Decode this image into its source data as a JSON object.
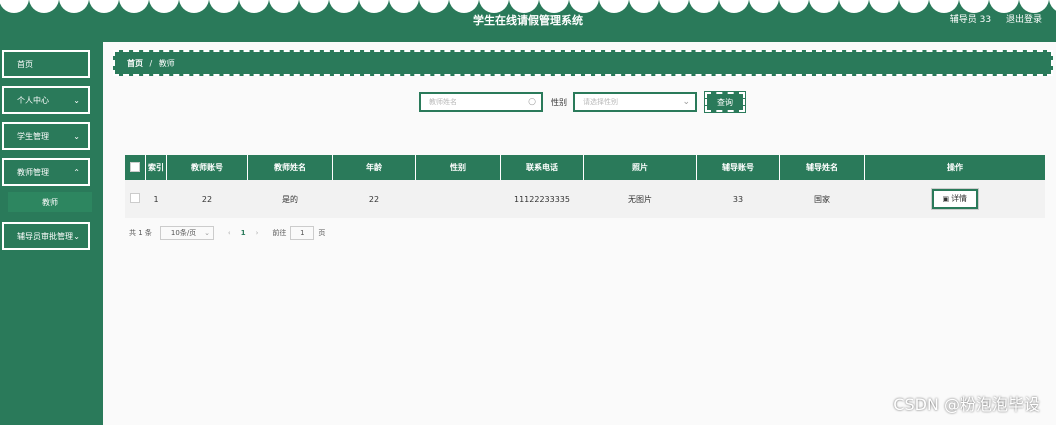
{
  "header": {
    "title": "学生在线请假管理系统",
    "user": "辅导员 33",
    "logout": "退出登录"
  },
  "sidebar": {
    "items": [
      {
        "label": "首页"
      },
      {
        "label": "个人中心"
      },
      {
        "label": "学生管理"
      },
      {
        "label": "教师管理"
      },
      {
        "label": "辅导员审批管理"
      }
    ],
    "submenu": "教师"
  },
  "breadcrumb": {
    "home": "首页",
    "sep": "/",
    "current": "教师"
  },
  "search": {
    "name_placeholder": "教师姓名",
    "gender_label": "性别",
    "gender_placeholder": "请选择性别",
    "query_label": "查询"
  },
  "table": {
    "headers": [
      "索引",
      "教师账号",
      "教师姓名",
      "年龄",
      "性别",
      "联系电话",
      "照片",
      "辅导账号",
      "辅导姓名",
      "操作"
    ],
    "rows": [
      {
        "index": "1",
        "account": "22",
        "name": "是的",
        "age": "22",
        "gender": "",
        "phone": "11122233335",
        "photo": "无图片",
        "counselor_account": "33",
        "counselor_name": "国家",
        "action": "详情"
      }
    ]
  },
  "pager": {
    "total": "共 1 条",
    "size": "10条/页",
    "current": "1",
    "goto": "前往",
    "goto_value": "1",
    "page_unit": "页"
  },
  "watermark": "CSDN @粉泡泡毕设"
}
